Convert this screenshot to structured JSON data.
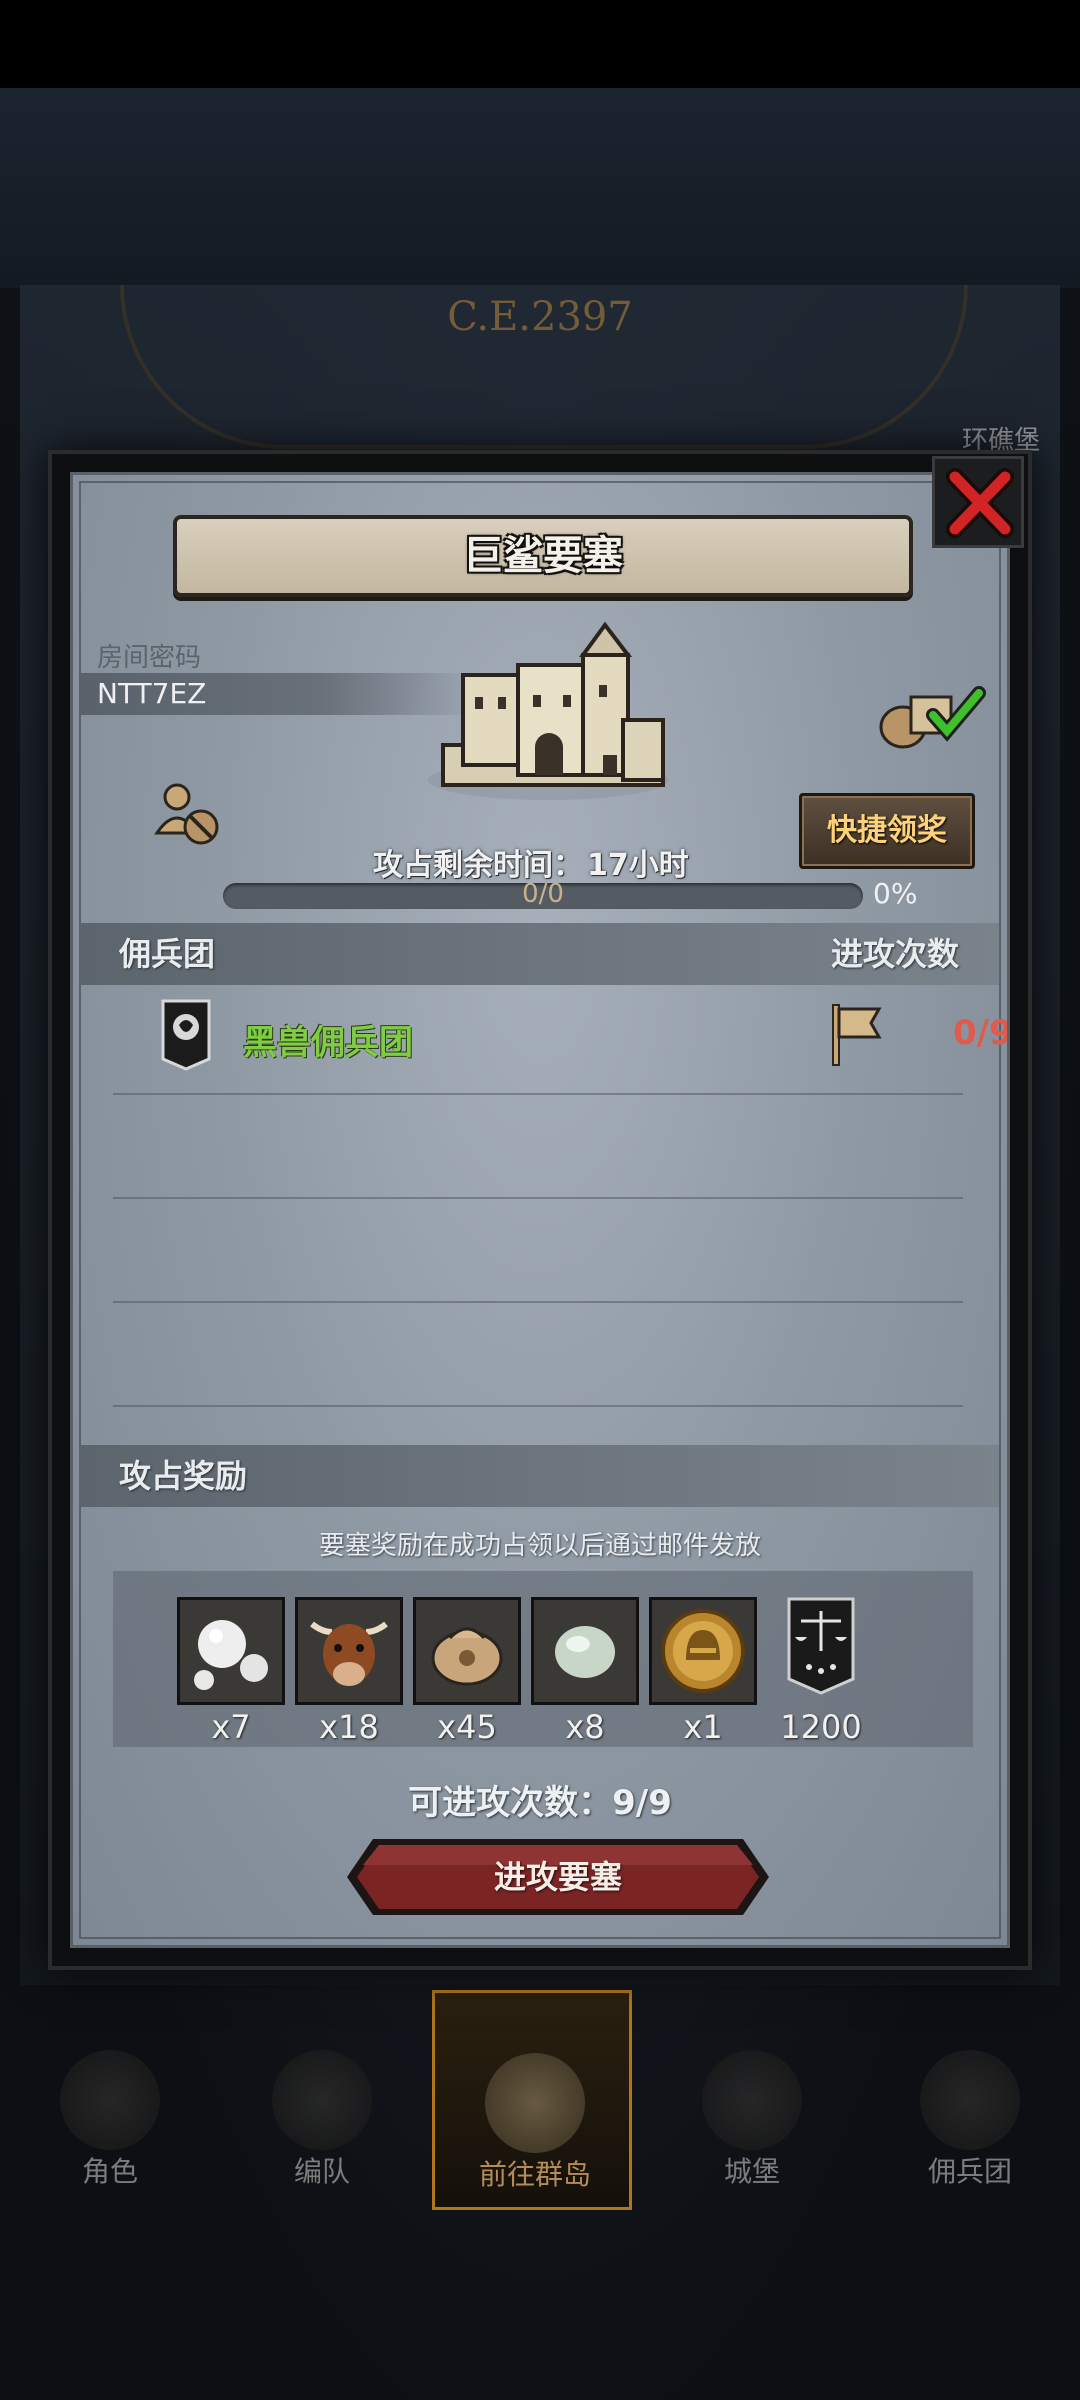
{
  "background": {
    "era_label": "C.E.2397",
    "right_label": "环礁堡"
  },
  "modal": {
    "title": "巨鲨要塞",
    "room_code_label": "房间密码",
    "room_code": "NTT7EZ",
    "quick_claim": "快捷领奖",
    "time_left_label": "攻占剩余时间：",
    "time_left_value": "17小时",
    "progress": {
      "text": "0/0",
      "percent_label": "0%",
      "fraction": 0
    },
    "mercenary_section": {
      "title": "佣兵团",
      "right": "进攻次数"
    },
    "mercenaries": [
      {
        "name": "黑兽佣兵团",
        "attacks": "0/9"
      }
    ],
    "rewards_section": {
      "title": "攻占奖励"
    },
    "rewards_note": "要塞奖励在成功占领以后通过邮件发放",
    "rewards": [
      {
        "icon": "pearl-icon",
        "qty": "x7"
      },
      {
        "icon": "ox-icon",
        "qty": "x18"
      },
      {
        "icon": "sack-icon",
        "qty": "x45"
      },
      {
        "icon": "stone-icon",
        "qty": "x8"
      },
      {
        "icon": "helmet-coin-icon",
        "qty": "x1"
      },
      {
        "icon": "justice-banner-icon",
        "qty": "1200"
      }
    ],
    "attacks_available_label": "可进攻次数：9/9",
    "attack_button": "进攻要塞"
  },
  "bottom_nav": [
    {
      "label": "角色",
      "active": false
    },
    {
      "label": "编队",
      "active": false
    },
    {
      "label": "前往群岛",
      "active": true
    },
    {
      "label": "城堡",
      "active": false
    },
    {
      "label": "佣兵团",
      "active": false
    }
  ],
  "colors": {
    "merc_name": "#7fce42",
    "attack_count": "#e05a4e",
    "quick_claim_text": "#ffd27a",
    "attack_button": "#7a2424"
  }
}
